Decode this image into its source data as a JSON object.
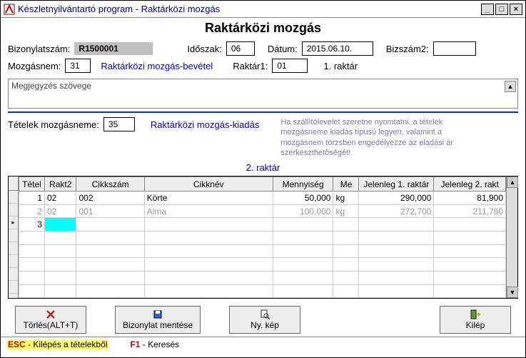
{
  "window": {
    "title": "Készletnyilvántartó program - Raktárközi mozgás"
  },
  "heading": "Raktárközi mozgás",
  "row1": {
    "bizonylat_label": "Bizonylatszám:",
    "bizonylat_val": "R1500001",
    "idoszak_label": "Időszak:",
    "idoszak_val": "06",
    "datum_label": "Dátum:",
    "datum_val": "2015.06.10.",
    "bizszam2_label": "Bizszám2:",
    "bizszam2_val": ""
  },
  "row2": {
    "mozgasnem_label": "Mozgásnem:",
    "mozgasnem_val": "31",
    "mozgasnem_desc": "Raktárközi mozgás-bevétel",
    "raktar1_label": "Raktár1:",
    "raktar1_val": "01",
    "raktar1_desc": "1. raktár"
  },
  "notes": "Megjegyzés szövege",
  "row3": {
    "tetek_label": "Tételek mozgásneme:",
    "tetek_val": "35",
    "tetek_desc": "Raktárközi mozgás-kiadás",
    "hint": "Ha szállítólevelet szeretne nyomtatni, a tételek mozgásneme kiadás típusú legyen, valamint a mozgásnem törzsben engedélyezze az eladási ár szerkeszthetőségét!"
  },
  "raktar2_text": "2. raktár",
  "grid": {
    "headers": {
      "tetel": "Tétel",
      "rakt2": "Rakt2",
      "cikkszam": "Cikkszám",
      "cikknev": "Cikknév",
      "mennyiseg": "Mennyiség",
      "me": "Me",
      "jelenleg1": "Jelenleg 1. raktár",
      "jelenleg2": "Jelenleg 2. rakt"
    },
    "rows": [
      {
        "tetel": "1",
        "rakt2": "02",
        "cikkszam": "002",
        "cikknev": "Körte",
        "mennyiseg": "50,000",
        "me": "kg",
        "j1": "290,000",
        "j2": "81,900"
      },
      {
        "tetel": "2",
        "rakt2": "02",
        "cikkszam": "001",
        "cikknev": "Alma",
        "mennyiseg": "100,000",
        "me": "kg",
        "j1": "272,700",
        "j2": "211,780"
      },
      {
        "tetel": "3",
        "rakt2": "",
        "cikkszam": "",
        "cikknev": "",
        "mennyiseg": "",
        "me": "",
        "j1": "",
        "j2": ""
      }
    ]
  },
  "buttons": {
    "torles": "Törlés(ALT+T)",
    "mentes": "Bizonylat mentése",
    "nykep": "Ny. kép",
    "kilep": "Kilép"
  },
  "status": {
    "esc_key": "ESC",
    "esc_text": " - Kilépés a tételekből",
    "f1_key": "F1",
    "f1_text": " - Keresés"
  }
}
